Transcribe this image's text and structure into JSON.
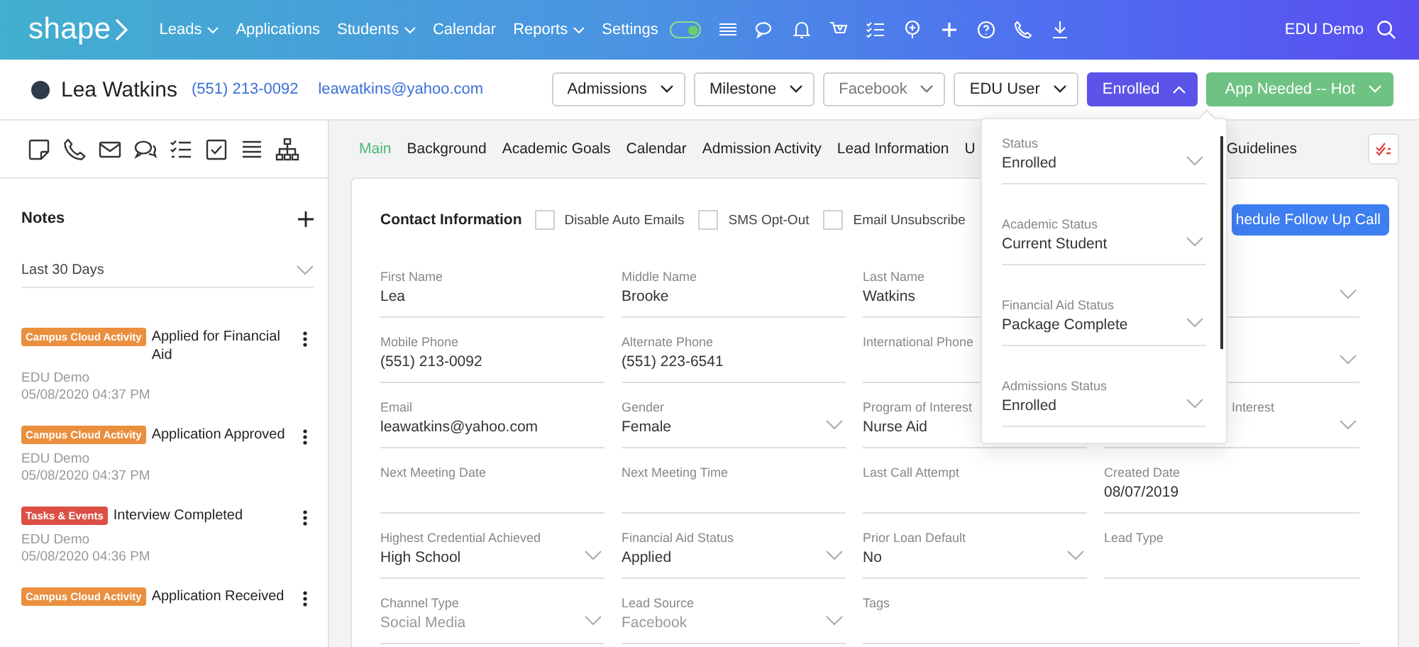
{
  "nav": {
    "logo": "shape",
    "items": [
      {
        "label": "Leads",
        "dropdown": true
      },
      {
        "label": "Applications",
        "dropdown": false
      },
      {
        "label": "Students",
        "dropdown": true
      },
      {
        "label": "Calendar",
        "dropdown": false
      },
      {
        "label": "Reports",
        "dropdown": true
      },
      {
        "label": "Settings",
        "dropdown": false
      }
    ],
    "toggle": {
      "on": true
    },
    "user": "EDU Demo"
  },
  "contact": {
    "name": "Lea Watkins",
    "phone": "(551) 213-0092",
    "email": "leawatkins@yahoo.com"
  },
  "header_buttons": [
    {
      "label": "Admissions",
      "kind": "outline",
      "expanded": false
    },
    {
      "label": "Milestone",
      "kind": "outline",
      "expanded": false
    },
    {
      "label": "Facebook",
      "kind": "muted",
      "expanded": false
    },
    {
      "label": "EDU User",
      "kind": "outline",
      "expanded": false
    },
    {
      "label": "Enrolled",
      "kind": "primary",
      "expanded": true
    },
    {
      "label": "App Needed -- Hot",
      "kind": "success",
      "expanded": false
    }
  ],
  "notes": {
    "title": "Notes",
    "filter": "Last 30 Days",
    "items": [
      {
        "tag": "Campus Cloud Activity",
        "color": "#ea8f3e",
        "title": "Applied for Financial Aid",
        "author": "EDU Demo",
        "date": "05/08/2020 04:37 PM"
      },
      {
        "tag": "Campus Cloud Activity",
        "color": "#ea8f3e",
        "title": "Application Approved",
        "author": "EDU Demo",
        "date": "05/08/2020 04:37 PM"
      },
      {
        "tag": "Tasks & Events",
        "color": "#dc4f45",
        "title": "Interview Completed",
        "author": "EDU Demo",
        "date": "05/08/2020 04:36 PM"
      },
      {
        "tag": "Campus Cloud Activity",
        "color": "#ea8f3e",
        "title": "Application Received"
      }
    ]
  },
  "tabs": [
    {
      "label": "Main",
      "selected": true
    },
    {
      "label": "Background",
      "selected": false
    },
    {
      "label": "Academic Goals",
      "selected": false
    },
    {
      "label": "Calendar",
      "selected": false
    },
    {
      "label": "Admission Activity",
      "selected": false
    },
    {
      "label": "Lead Information",
      "selected": false
    },
    {
      "label": "U",
      "selected": false
    },
    {
      "label": "Guidelines",
      "selected": false
    }
  ],
  "card": {
    "title": "Contact Information",
    "checkboxes": [
      {
        "label": "Disable Auto Emails",
        "checked": false
      },
      {
        "label": "SMS Opt-Out",
        "checked": false
      },
      {
        "label": "Email Unsubscribe",
        "checked": false
      }
    ],
    "action": "hedule Follow Up Call",
    "fields": [
      {
        "label": "First Name",
        "value": "Lea",
        "kind": "text",
        "partial": false
      },
      {
        "label": "Middle Name",
        "value": "Brooke",
        "kind": "text",
        "partial": false
      },
      {
        "label": "Last Name",
        "value": "Watkins",
        "kind": "text",
        "partial": false
      },
      {
        "kind": "select"
      },
      {
        "label": "Mobile Phone",
        "value": "(551) 213-0092",
        "kind": "text",
        "partial": false
      },
      {
        "label": "Alternate Phone",
        "value": "(551) 223-6541",
        "kind": "text",
        "partial": false
      },
      {
        "label": "International Phone",
        "kind": "text",
        "partial": false
      },
      {
        "kind": "select"
      },
      {
        "label": "Email",
        "value": "leawatkins@yahoo.com",
        "kind": "text",
        "partial": false
      },
      {
        "label": "Gender",
        "value": "Female",
        "kind": "select",
        "partial": false
      },
      {
        "label": "Program of Interest",
        "value": "Nurse Aid",
        "kind": "text",
        "partial": false
      },
      {
        "label": "Interest",
        "kind": "select",
        "partial": true
      },
      {
        "label": "Next Meeting Date",
        "kind": "text",
        "partial": false
      },
      {
        "label": "Next Meeting Time",
        "kind": "text",
        "partial": false
      },
      {
        "label": "Last Call Attempt",
        "kind": "text",
        "partial": false
      },
      {
        "label": "Created Date",
        "value": "08/07/2019",
        "kind": "text",
        "partial": false
      },
      {
        "label": "Highest Credential Achieved",
        "value": "High School",
        "kind": "select",
        "partial": false
      },
      {
        "label": "Financial Aid Status",
        "value": "Applied",
        "kind": "select",
        "partial": false
      },
      {
        "label": "Prior Loan Default",
        "value": "No",
        "kind": "select",
        "partial": false
      },
      {
        "label": "Lead Type",
        "kind": "text",
        "partial": false
      },
      {
        "label": "Channel Type",
        "placeholder": "Social Media",
        "kind": "select",
        "partial": false
      },
      {
        "label": "Lead Source",
        "placeholder": "Facebook",
        "kind": "select",
        "partial": false
      },
      {
        "label": "Tags",
        "kind": "wide",
        "partial": false
      }
    ]
  },
  "status_popup": {
    "fields": [
      {
        "label": "Status",
        "value": "Enrolled"
      },
      {
        "label": "Academic Status",
        "value": "Current Student"
      },
      {
        "label": "Financial Aid Status",
        "value": "Package Complete"
      },
      {
        "label": "Admissions Status",
        "value": "Enrolled"
      }
    ]
  }
}
